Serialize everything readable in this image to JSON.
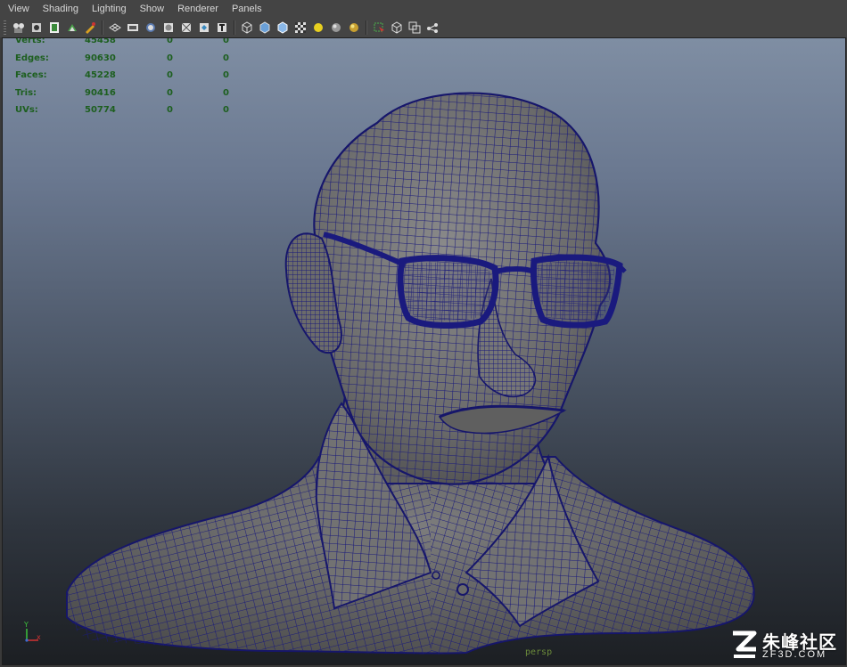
{
  "menu": [
    "View",
    "Shading",
    "Lighting",
    "Show",
    "Renderer",
    "Panels"
  ],
  "toolbar": {
    "groups": [
      [
        "camera-attributes-icon",
        "bookmarks-icon",
        "image-plane-icon",
        "2d-pan-zoom-icon",
        "grease-pencil-icon"
      ],
      [
        "grid-icon",
        "film-gate-icon",
        "resolution-gate-icon",
        "gate-mask-icon",
        "field-chart-icon",
        "safe-action-icon",
        "safe-title-icon"
      ],
      [
        "wireframe-icon",
        "smooth-shade-icon",
        "default-material-icon",
        "textured-icon",
        "use-all-lights-icon",
        "shadows-icon",
        "ambient-occlusion-icon"
      ],
      [
        "select-camera-icon",
        "isolate-select-icon",
        "xray-icon",
        "xray-joints-icon"
      ]
    ]
  },
  "hud": {
    "color": "#1d5f1f",
    "rows": [
      {
        "label": "Verts:",
        "values": [
          "45458",
          "0",
          "0"
        ]
      },
      {
        "label": "Edges:",
        "values": [
          "90630",
          "0",
          "0"
        ]
      },
      {
        "label": "Faces:",
        "values": [
          "45228",
          "0",
          "0"
        ]
      },
      {
        "label": "Tris:",
        "values": [
          "90416",
          "0",
          "0"
        ]
      },
      {
        "label": "UVs:",
        "values": [
          "50774",
          "0",
          "0"
        ]
      }
    ]
  },
  "axis": {
    "x": "x",
    "y": "Y"
  },
  "camera": "persp",
  "watermark": {
    "text": "朱峰社区",
    "sub": "ZF3D.COM"
  },
  "colors": {
    "wire": "#1a1a7a",
    "mesh": "#6f6f6f"
  }
}
